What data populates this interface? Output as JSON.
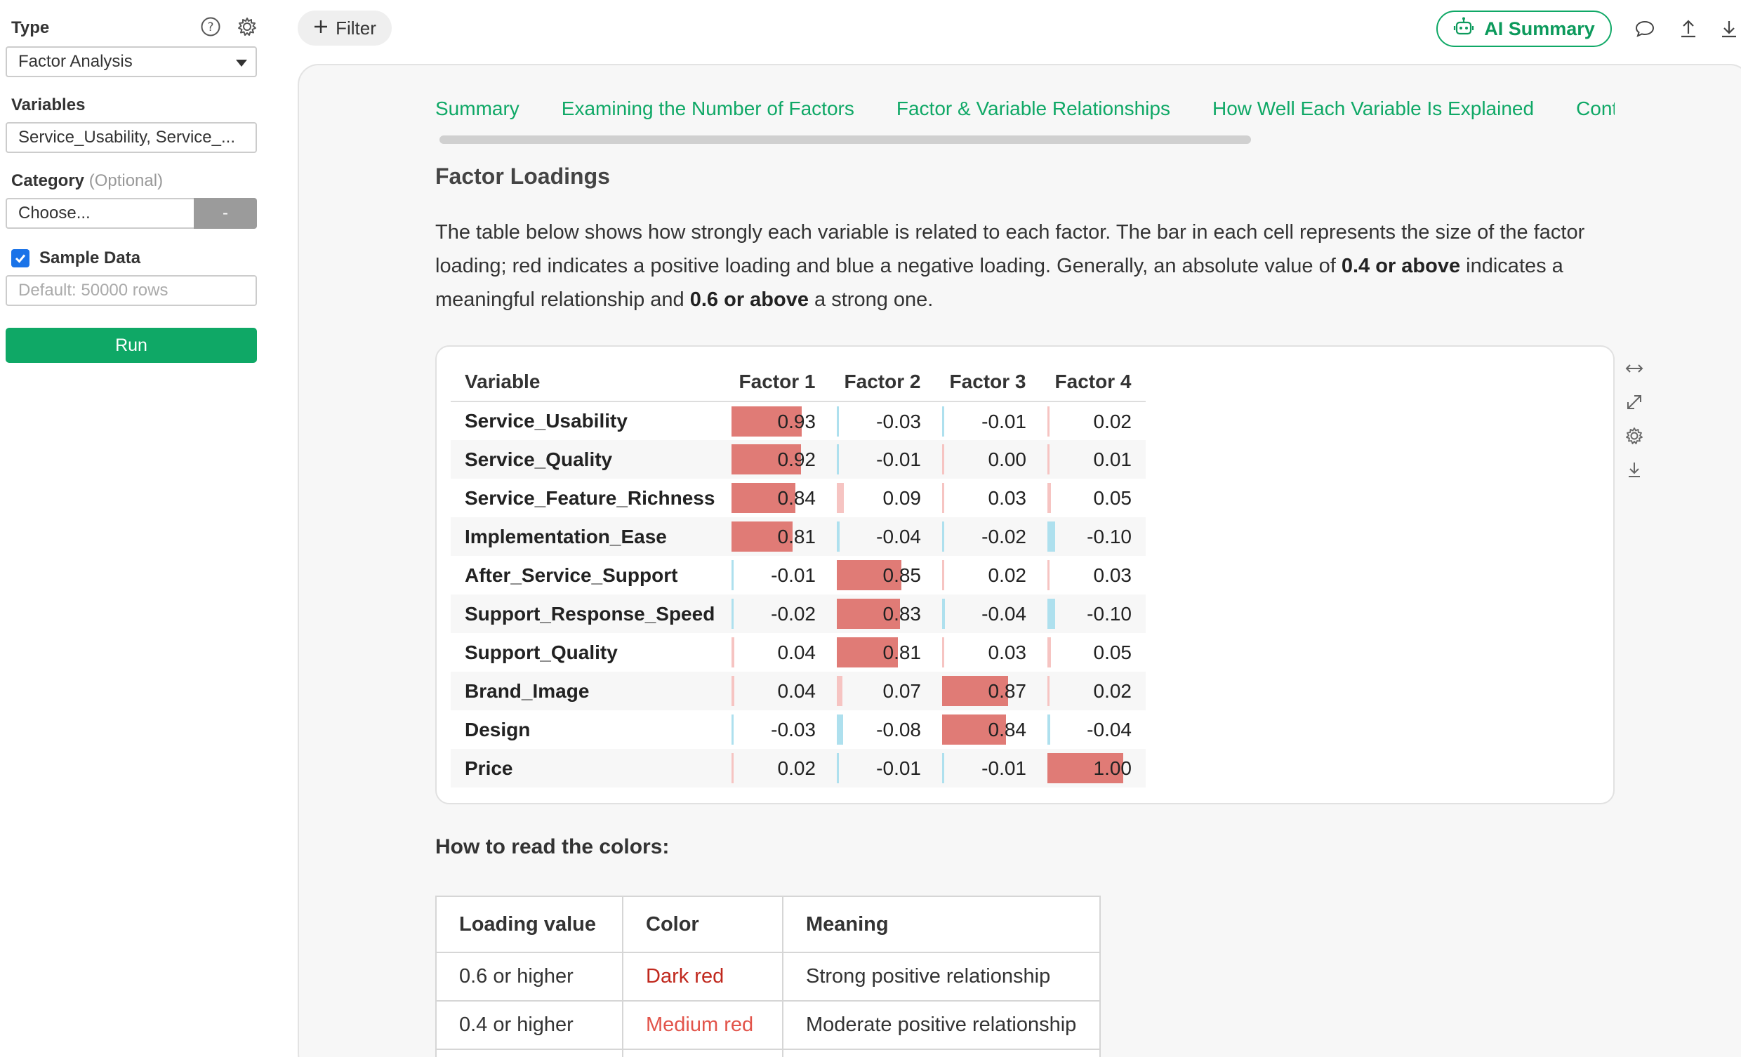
{
  "sidebar": {
    "type_label": "Type",
    "type_value": "Factor Analysis",
    "variables_label": "Variables",
    "variables_value": "Service_Usability, Service_...",
    "category_label": "Category",
    "category_optional": "(Optional)",
    "category_placeholder": "Choose...",
    "category_button": "-",
    "sample_data_label": "Sample Data",
    "sample_data_checked": true,
    "sample_rows_placeholder": "Default: 50000 rows",
    "run_label": "Run"
  },
  "topbar": {
    "filter_label": "Filter",
    "ai_summary_label": "AI Summary"
  },
  "tabs": [
    "Summary",
    "Examining the Number of Factors",
    "Factor & Variable Relationships",
    "How Well Each Variable Is Explained",
    "Cont"
  ],
  "section": {
    "title": "Factor Loadings",
    "desc_1": "The table below shows how strongly each variable is related to each factor. The bar in each cell represents the size of the factor loading; red indicates a positive loading and blue a negative loading. Generally, an absolute value of ",
    "desc_bold_1": "0.4 or above",
    "desc_2": " indicates a meaningful relationship and ",
    "desc_bold_2": "0.6 or above",
    "desc_3": " a strong one."
  },
  "loadings": {
    "columns": [
      "Variable",
      "Factor 1",
      "Factor 2",
      "Factor 3",
      "Factor 4"
    ],
    "rows": [
      {
        "variable": "Service_Usability",
        "values": [
          "0.93",
          "-0.03",
          "-0.01",
          "0.02"
        ]
      },
      {
        "variable": "Service_Quality",
        "values": [
          "0.92",
          "-0.01",
          "0.00",
          "0.01"
        ]
      },
      {
        "variable": "Service_Feature_Richness",
        "values": [
          "0.84",
          "0.09",
          "0.03",
          "0.05"
        ]
      },
      {
        "variable": "Implementation_Ease",
        "values": [
          "0.81",
          "-0.04",
          "-0.02",
          "-0.10"
        ]
      },
      {
        "variable": "After_Service_Support",
        "values": [
          "-0.01",
          "0.85",
          "0.02",
          "0.03"
        ]
      },
      {
        "variable": "Support_Response_Speed",
        "values": [
          "-0.02",
          "0.83",
          "-0.04",
          "-0.10"
        ]
      },
      {
        "variable": "Support_Quality",
        "values": [
          "0.04",
          "0.81",
          "0.03",
          "0.05"
        ]
      },
      {
        "variable": "Brand_Image",
        "values": [
          "0.04",
          "0.07",
          "0.87",
          "0.02"
        ]
      },
      {
        "variable": "Design",
        "values": [
          "-0.03",
          "-0.08",
          "0.84",
          "-0.04"
        ]
      },
      {
        "variable": "Price",
        "values": [
          "0.02",
          "-0.01",
          "-0.01",
          "1.00"
        ]
      }
    ],
    "colors": {
      "strong_positive": "#e07b76",
      "weak_positive": "#f6c4c2",
      "negative": "#aee0ee"
    }
  },
  "legend": {
    "title": "How to read the colors:",
    "headers": [
      "Loading value",
      "Color",
      "Meaning"
    ],
    "rows": [
      {
        "value": "0.6 or higher",
        "color": "Dark red",
        "color_hex": "#c0281d",
        "meaning": "Strong positive relationship"
      },
      {
        "value": "0.4 or higher",
        "color": "Medium red",
        "color_hex": "#e2544a",
        "meaning": "Moderate positive relationship"
      }
    ]
  },
  "icons": [
    "help-icon",
    "gear-icon",
    "plus-icon",
    "robot-icon",
    "comment-icon",
    "upload-icon",
    "download-icon",
    "expand-horizontal-icon",
    "fullscreen-icon",
    "settings-icon",
    "download-icon"
  ]
}
